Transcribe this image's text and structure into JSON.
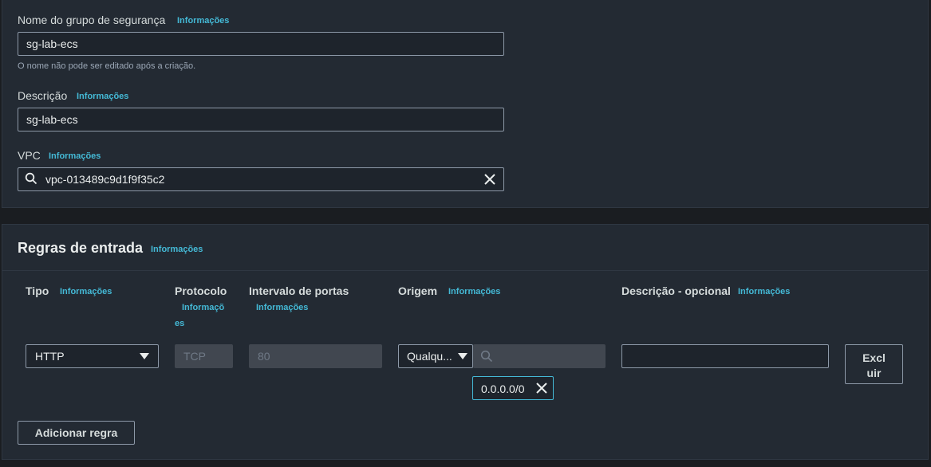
{
  "basic": {
    "name_label": "Nome do grupo de segurança",
    "name_info": "Informações",
    "name_value": "sg-lab-ecs",
    "name_hint": "O nome não pode ser editado após a criação.",
    "desc_label": "Descrição",
    "desc_info": "Informações",
    "desc_value": "sg-lab-ecs",
    "vpc_label": "VPC",
    "vpc_info": "Informações",
    "vpc_value": "vpc-013489c9d1f9f35c2"
  },
  "inbound": {
    "title": "Regras de entrada",
    "title_info": "Informações",
    "columns": {
      "type": "Tipo",
      "type_info": "Informações",
      "protocol": "Protocolo",
      "protocol_info_1": "Informaçõ",
      "protocol_info_2": "es",
      "port_range": "Intervalo de portas",
      "port_info": "Informações",
      "source": "Origem",
      "source_info": "Informações",
      "description": "Descrição - opcional",
      "description_info": "Informações"
    },
    "row": {
      "type_value": "HTTP",
      "protocol_value": "TCP",
      "port_value": "80",
      "source_value": "Qualqu...",
      "source_search_placeholder": "",
      "cidr_token": "0.0.0.0/0",
      "description_value": "",
      "delete_label_1": "Excl",
      "delete_label_2": "uir"
    },
    "add_rule_label": "Adicionar regra"
  }
}
